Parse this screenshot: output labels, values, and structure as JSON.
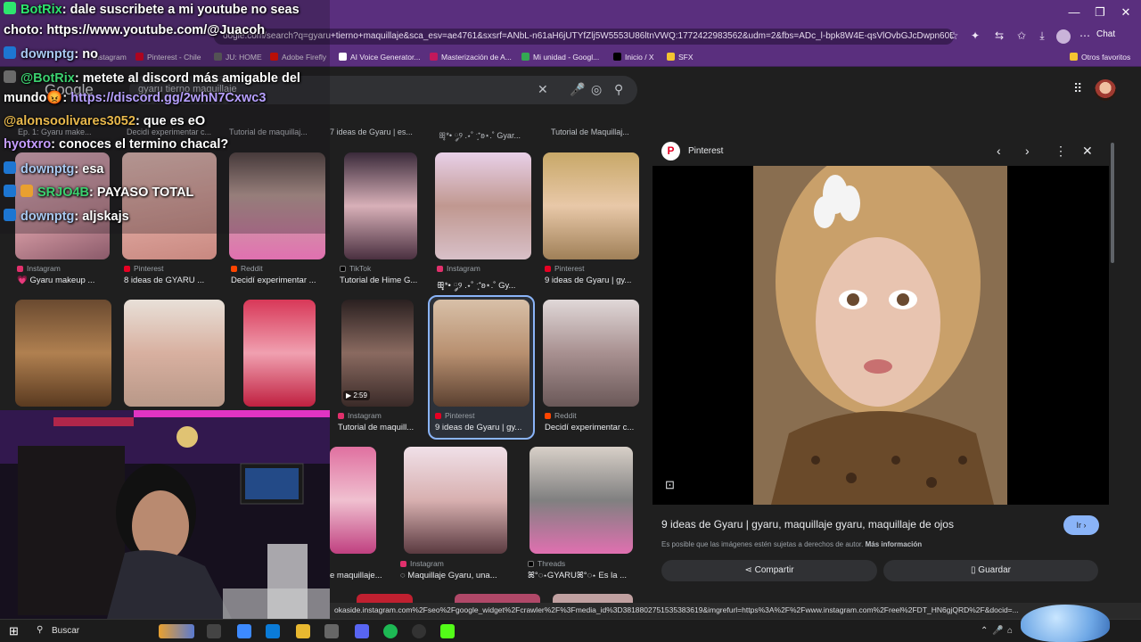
{
  "browser": {
    "address_url": "oogle.com/search?q=gyaru+tierno+maquillaje&sca_esv=ae4761&sxsrf=ANbL-n61aH6jUTYfZlj5W5553U86ltnVWQ:1772422983562&udm=2&fbs=ADc_l-bpk8W4E-qsVlOvbGJcDwpn60DczFdcvPnuv8WQohHLTcTH442KskDyC74HpRHrYUorhqI...",
    "chat_label": "Chat",
    "bookmarks": [
      {
        "label": "Instagram",
        "color": "#e1306c"
      },
      {
        "label": "Pinterest - Chile",
        "color": "#e60023"
      },
      {
        "label": "JU: HOME",
        "color": "#6b6b6b"
      },
      {
        "label": "Adobe Firefly",
        "color": "#fa0f00"
      },
      {
        "label": "AI Voice Generator...",
        "color": "#ffffff"
      },
      {
        "label": "Masterización de A...",
        "color": "#c2185b"
      },
      {
        "label": "Mi unidad - Googl...",
        "color": "#34a853"
      },
      {
        "label": "Inicio / X",
        "color": "#000000"
      },
      {
        "label": "SFX",
        "color": "#f4c430"
      }
    ],
    "other_bookmarks": "Otros favoritos"
  },
  "google": {
    "logo": "Google",
    "query": "gyaru tierno maquillaje"
  },
  "strip_captions": [
    "Ep. 1: Gyaru make...",
    "Decidí experimentar c...",
    "Tutorial de maquillaj...",
    "7 ideas de Gyaru | es...",
    "ꕥ̥*• ༘୨ .⋆˚ ˑ͙⁺ʚ⋆.˚ Gyar...",
    "Tutorial de Maquillaj..."
  ],
  "row1": [
    {
      "source": "Instagram",
      "caption": "💗 Gyaru makeup ...",
      "color": "#e1306c"
    },
    {
      "source": "Pinterest",
      "caption": "8 ideas de GYARU ...",
      "color": "#e60023"
    },
    {
      "source": "Reddit",
      "caption": "Decidí experimentar ...",
      "color": "#ff4500"
    },
    {
      "source": "TikTok",
      "caption": "Tutorial de Hime G...",
      "color": "#000000"
    },
    {
      "source": "Instagram",
      "caption": "ꕥ̥*• ༘୨ .⋆˚ ˑ͙⁺ʚ⋆.˚ Gy...",
      "color": "#e1306c"
    },
    {
      "source": "Pinterest",
      "caption": "9 ideas de Gyaru | gy...",
      "color": "#e60023"
    }
  ],
  "row2": [
    {
      "source": "Instagram",
      "caption": "Tutorial de maquill...",
      "color": "#e1306c"
    },
    {
      "source": "Pinterest",
      "caption": "9 ideas de Gyaru | gy...",
      "color": "#e60023"
    },
    {
      "source": "Reddit",
      "caption": "Decidí experimentar c...",
      "color": "#ff4500"
    }
  ],
  "row3": [
    {
      "source": "",
      "caption": "e maquillaje...",
      "color": "#000000"
    },
    {
      "source": "Instagram",
      "caption": "◌ Maquillaje Gyaru, una...",
      "color": "#e1306c"
    },
    {
      "source": "Threads",
      "caption": "ꕤ°◌⋆GYARUꕤ°◌⋆ Es la ...",
      "color": "#000000"
    }
  ],
  "video_duration": "▶ 2:59",
  "panel": {
    "site": "Pinterest",
    "title": "9 ideas de Gyaru | gyaru, maquillaje gyaru, maquillaje de ojos",
    "go_label": "Ir ›",
    "copyright": "Es posible que las imágenes estén sujetas a derechos de autor.",
    "more_info": "Más información",
    "share": "Compartir",
    "save": "Guardar"
  },
  "status_url": "okaside.instagram.com%2Fseo%2Fgoogle_widget%2Fcrawler%2F%3Fmedia_id%3D3818802751535383619&imgrefurl=https%3A%2F%2Fwww.instagram.com%2Freel%2FDT_HN6gjQRD%2F&docid=...",
  "status_prefix": "ht",
  "taskbar": {
    "search": "Buscar"
  },
  "chat": {
    "lines": [
      {
        "user": "BotRix",
        "text": ": dale suscribete a mi youtube no seas"
      },
      {
        "text": "choto: https://www.youtube.com/@Juacoh"
      },
      {
        "user": "downptg",
        "text": ": no"
      },
      {
        "user": "@BotRix",
        "text": ": metete al discord más amigable del"
      },
      {
        "text": "mundo😡: ",
        "link": "https://discord.gg/2whN7Cxwc3"
      },
      {
        "user": "@alonsoolivares3052",
        "text": ": que es eO"
      },
      {
        "user": "hyotxro",
        "text": ": conoces el termino chacal?"
      },
      {
        "user": "downptg",
        "text": ": esa"
      },
      {
        "user": "SRJO4B",
        "text": ": PAYASO TOTAL"
      },
      {
        "user": "downptg",
        "text": ": aljskajs"
      }
    ]
  }
}
